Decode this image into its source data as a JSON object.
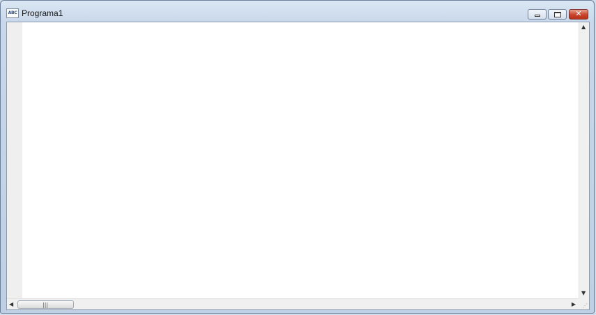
{
  "window": {
    "title": "Programa1",
    "icon": "abc-document-icon",
    "icon_text": "ABC"
  },
  "controls": {
    "minimize_glyph": "",
    "maximize_glyph": "",
    "close_glyph": "✕"
  },
  "editor": {
    "content": ""
  },
  "scrollbars": {
    "up": "▲",
    "down": "▼",
    "left": "◀",
    "right": "▶",
    "grip": "|||",
    "size_grip": "⋰"
  }
}
